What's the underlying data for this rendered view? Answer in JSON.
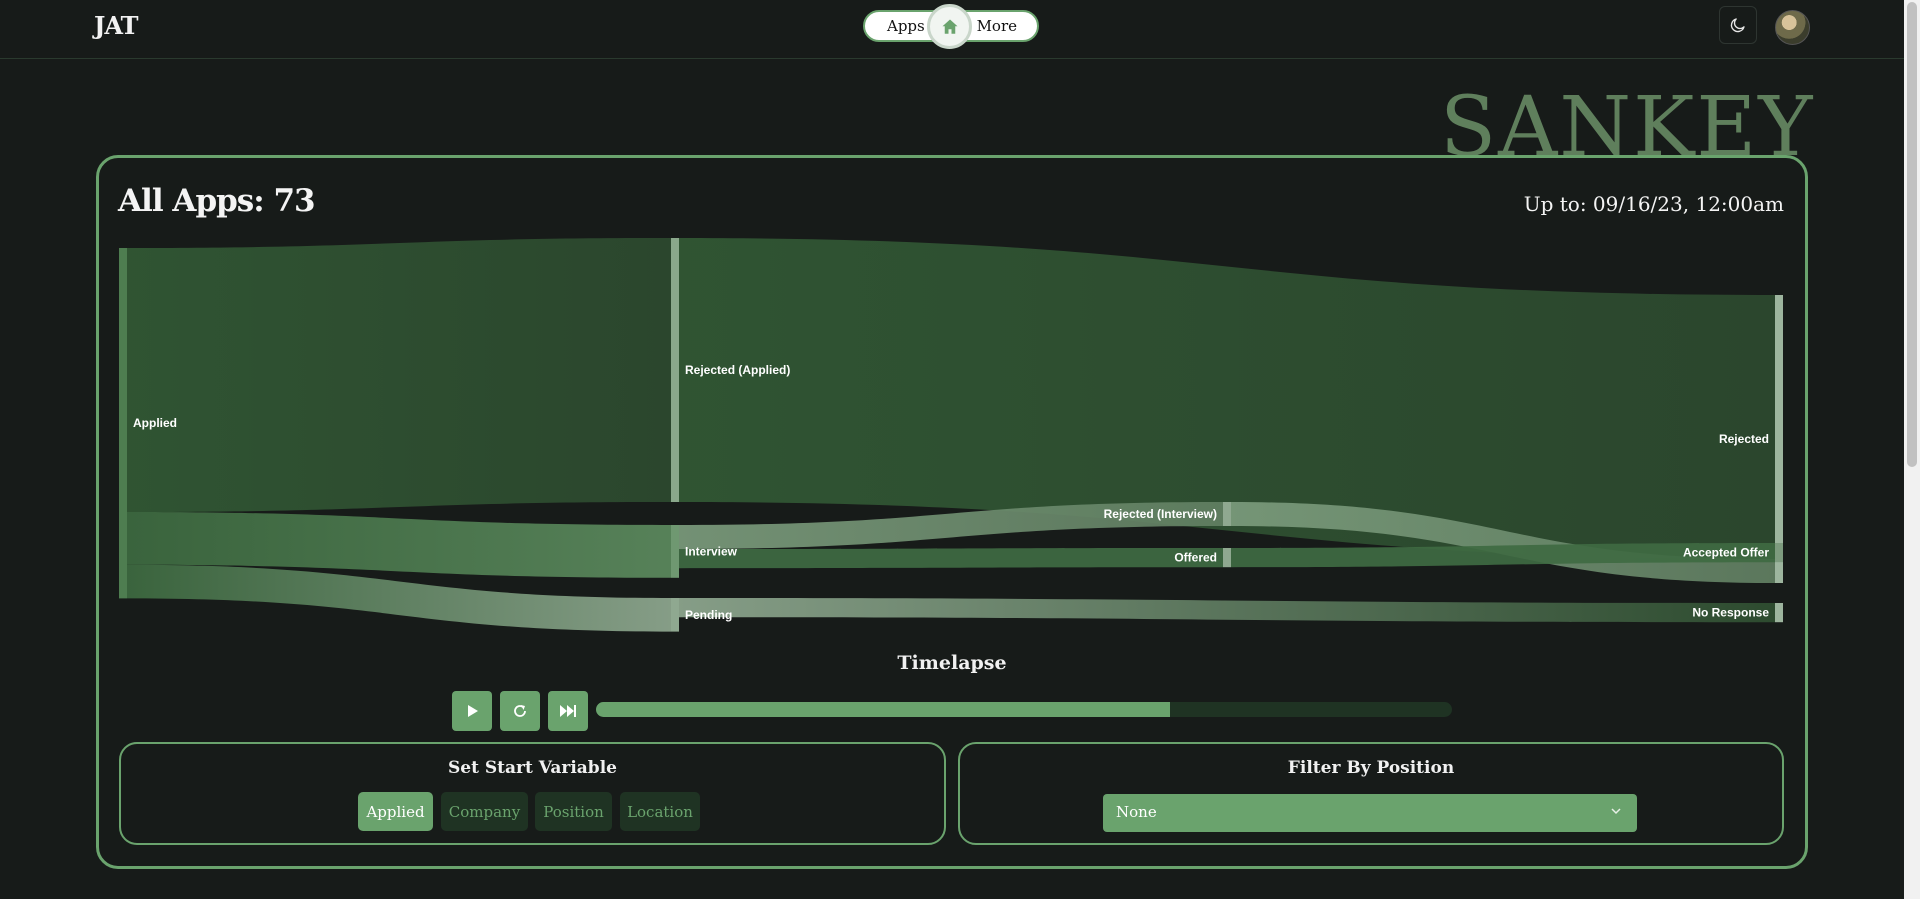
{
  "nav": {
    "logo": "JAT",
    "apps_label": "Apps",
    "more_label": "More",
    "home_icon": "home-icon",
    "theme_icon": "moon-icon"
  },
  "watermark": "SANKEY",
  "header": {
    "title": "All Apps: 73",
    "up_to": "Up to: 09/16/23, 12:00am"
  },
  "chart_data": {
    "type": "sankey",
    "nodes": [
      "Applied",
      "Rejected (Applied)",
      "Interview",
      "Pending",
      "Rejected (Interview)",
      "Offered",
      "Rejected",
      "Accepted Offer",
      "No Response"
    ],
    "links": [
      {
        "source": "Applied",
        "target": "Rejected (Applied)",
        "value": 55
      },
      {
        "source": "Applied",
        "target": "Interview",
        "value": 11
      },
      {
        "source": "Applied",
        "target": "Pending",
        "value": 7
      },
      {
        "source": "Rejected (Applied)",
        "target": "Rejected",
        "value": 55
      },
      {
        "source": "Interview",
        "target": "Rejected (Interview)",
        "value": 5
      },
      {
        "source": "Interview",
        "target": "Offered",
        "value": 4
      },
      {
        "source": "Rejected (Interview)",
        "target": "Rejected",
        "value": 5
      },
      {
        "source": "Offered",
        "target": "Accepted Offer",
        "value": 4
      },
      {
        "source": "Pending",
        "target": "No Response",
        "value": 4
      }
    ],
    "colors": {
      "flow": "#3b6b3e",
      "node": "#5e8c60",
      "node_light": "#9db59e"
    }
  },
  "timelapse": {
    "title": "Timelapse",
    "progress": 0.67,
    "buttons": [
      "play-icon",
      "replay-icon",
      "skip-forward-icon"
    ]
  },
  "start_variable": {
    "title": "Set Start Variable",
    "options": [
      "Applied",
      "Company",
      "Position",
      "Location"
    ],
    "selected": "Applied"
  },
  "filter": {
    "title": "Filter By Position",
    "value": "None"
  },
  "colors": {
    "accent": "#6aa36d",
    "background": "#171b19",
    "chip_bg": "#1f3323"
  }
}
